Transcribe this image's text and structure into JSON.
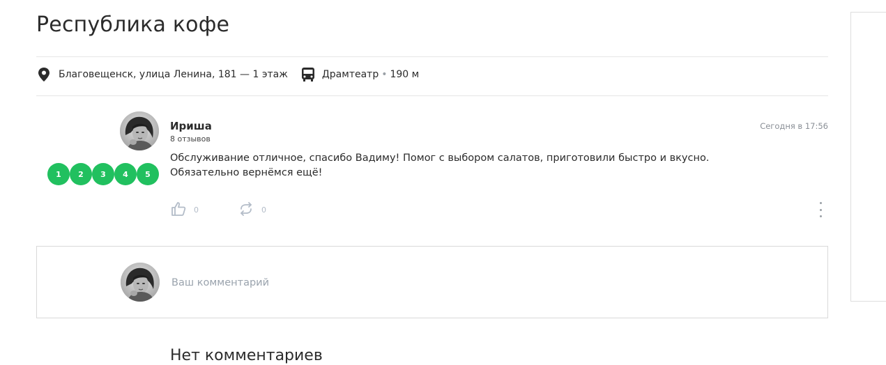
{
  "place": {
    "title": "Республика кофе",
    "address": "Благовещенск, улица Ленина, 181 — 1 этаж",
    "transit_stop": "Драмтеатр",
    "transit_distance": "190 м"
  },
  "review": {
    "author": "Ириша",
    "reviews_count": "8 отзывов",
    "date": "Сегодня в 17:56",
    "text_line1": "Обслуживание отличное, спасибо Вадиму! Помог с выбором салатов, приготовили быстро и вкусно.",
    "text_line2": "Обязательно вернёмся ещё!",
    "rating_labels": [
      "1",
      "2",
      "3",
      "4",
      "5"
    ],
    "likes": "0",
    "reposts": "0"
  },
  "comment": {
    "placeholder": "Ваш комментарий"
  },
  "comments_empty": "Нет комментариев",
  "colors": {
    "rating_green": "#21c05f",
    "muted_icon": "#b3bcc8"
  },
  "icons": [
    "location-pin-icon",
    "bus-icon",
    "thumbs-up-icon",
    "repost-icon",
    "more-vertical-icon"
  ]
}
